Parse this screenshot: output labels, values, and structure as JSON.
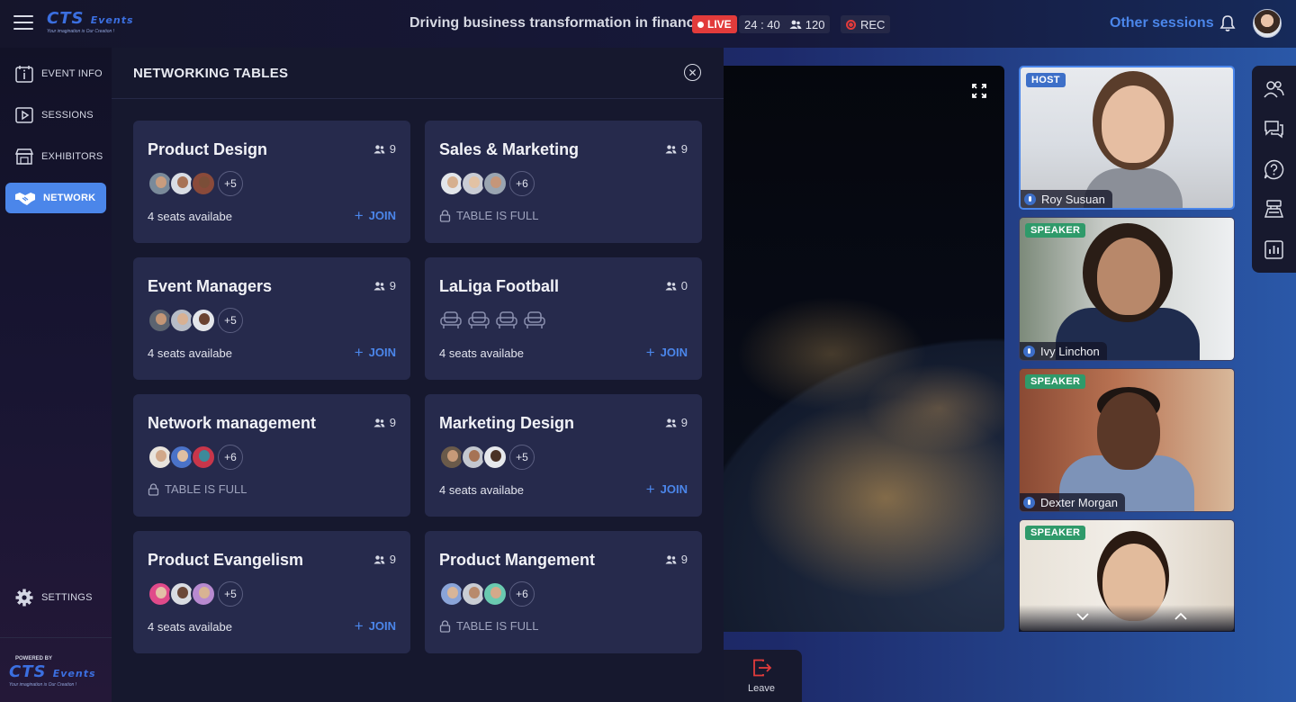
{
  "header": {
    "logo_main": "CTS",
    "logo_sub": "Events",
    "logo_tagline": "Your imagination is Our Creation !",
    "session_title": "Driving business transformation in finance",
    "live_label": "LIVE",
    "timer": "24 : 40",
    "attendees": "120",
    "rec_label": "REC",
    "other_sessions": "Other sessions"
  },
  "nav": {
    "items": [
      {
        "label": "EVENT INFO",
        "icon": "info-icon"
      },
      {
        "label": "SESSIONS",
        "icon": "play-icon"
      },
      {
        "label": "EXHIBITORS",
        "icon": "store-icon"
      },
      {
        "label": "NETWORK",
        "icon": "handshake-icon",
        "active": true
      }
    ],
    "settings": "SETTINGS",
    "powered_by": "POWERED BY"
  },
  "panel": {
    "title": "NETWORKING TABLES",
    "tables": [
      {
        "name": "Product Design",
        "count": "9",
        "more": "+5",
        "status": "4 seats availabe",
        "action": "JOIN"
      },
      {
        "name": "Sales & Marketing",
        "count": "9",
        "more": "+6",
        "status": "TABLE IS FULL"
      },
      {
        "name": "Event Managers",
        "count": "9",
        "more": "+5",
        "status": "4 seats availabe",
        "action": "JOIN"
      },
      {
        "name": "LaLiga Football",
        "count": "0",
        "status": "4 seats availabe",
        "action": "JOIN"
      },
      {
        "name": "Network management",
        "count": "9",
        "more": "+6",
        "status": "TABLE IS FULL"
      },
      {
        "name": "Marketing Design",
        "count": "9",
        "more": "+5",
        "status": "4 seats availabe",
        "action": "JOIN"
      },
      {
        "name": "Product Evangelism",
        "count": "9",
        "more": "+5",
        "status": "4 seats availabe",
        "action": "JOIN"
      },
      {
        "name": "Product Mangement",
        "count": "9",
        "more": "+6",
        "status": "TABLE IS FULL"
      }
    ]
  },
  "speakers": [
    {
      "role": "HOST",
      "name": "Roy Susuan"
    },
    {
      "role": "SPEAKER",
      "name": "Ivy Linchon"
    },
    {
      "role": "SPEAKER",
      "name": "Dexter Morgan"
    },
    {
      "role": "SPEAKER",
      "name": ""
    }
  ],
  "controls": {
    "leave": "Leave"
  },
  "colors": {
    "accent": "#4b86ea",
    "live": "#e23b3b",
    "speaker_badge": "#2f9a6a",
    "host_badge": "#3d6fc8",
    "card": "#262a4c"
  }
}
